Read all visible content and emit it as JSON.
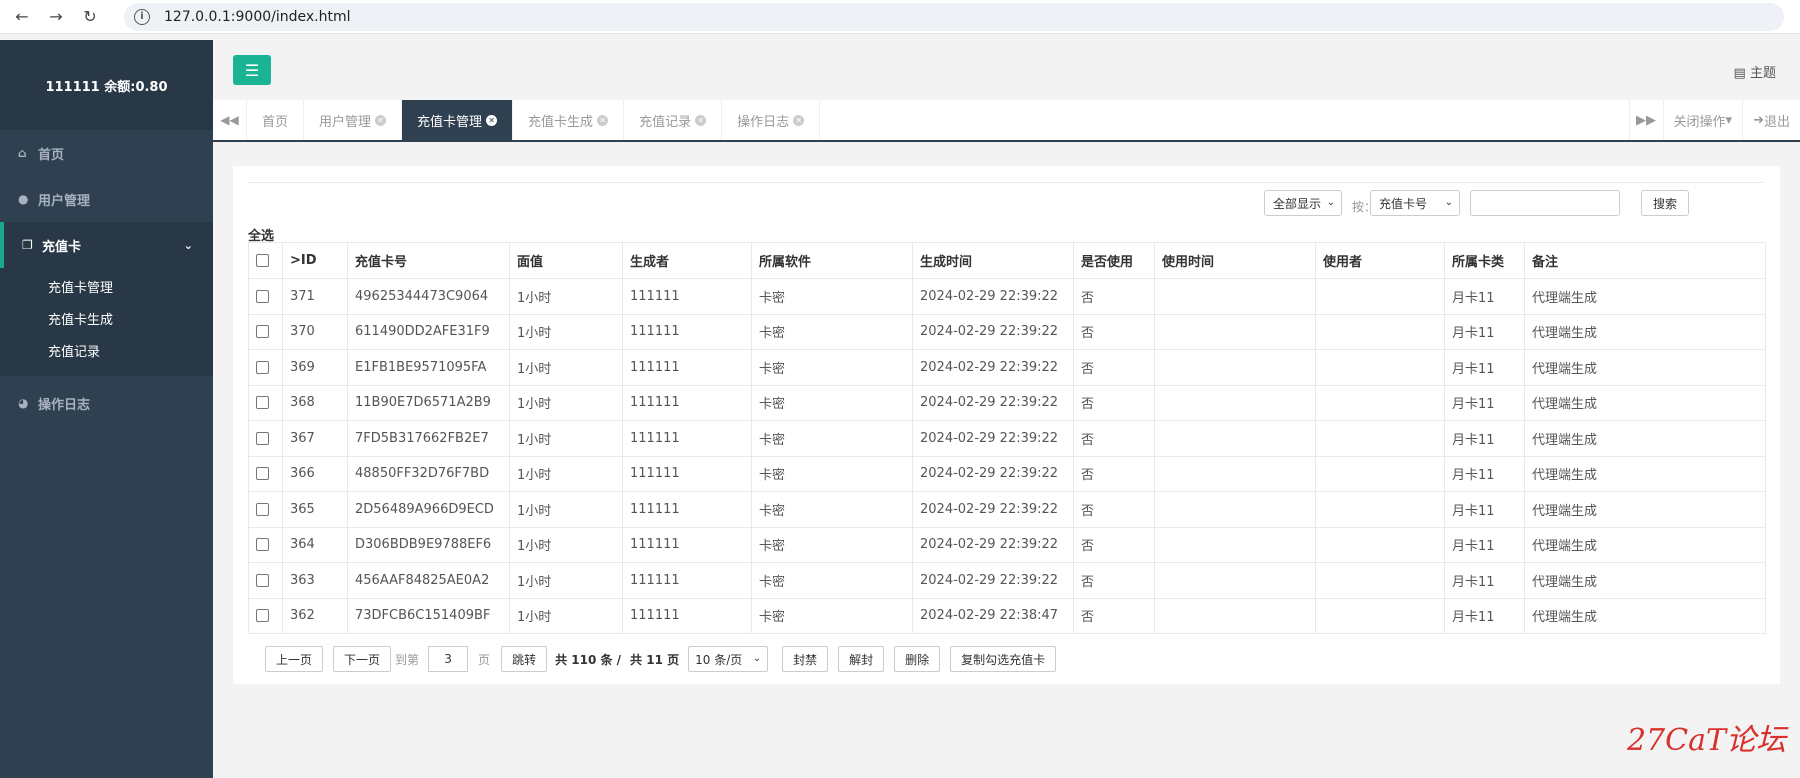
{
  "browser": {
    "url": "127.0.0.1:9000/index.html"
  },
  "sidebar": {
    "user_info": "111111 余额:0.80",
    "items": [
      {
        "label": "首页"
      },
      {
        "label": "用户管理"
      },
      {
        "label": "充值卡"
      },
      {
        "label": "操作日志"
      }
    ],
    "sub_items": [
      {
        "label": "充值卡管理"
      },
      {
        "label": "充值卡生成"
      },
      {
        "label": "充值记录"
      }
    ]
  },
  "header": {
    "theme_label": "主题"
  },
  "tabs": {
    "items": [
      {
        "label": "首页",
        "closable": false
      },
      {
        "label": "用户管理",
        "closable": true
      },
      {
        "label": "充值卡管理",
        "closable": true,
        "active": true
      },
      {
        "label": "充值卡生成",
        "closable": true
      },
      {
        "label": "充值记录",
        "closable": true
      },
      {
        "label": "操作日志",
        "closable": true
      }
    ],
    "close_ops": "关闭操作",
    "logout": "退出"
  },
  "filters": {
    "show_select": "全部显示",
    "by_label": "按：",
    "field_select": "充值卡号",
    "search_value": "",
    "search_button": "搜索"
  },
  "table": {
    "select_all": "全选",
    "headers": [
      "",
      ">ID",
      "充值卡号",
      "面值",
      "生成者",
      "所属软件",
      "生成时间",
      "是否使用",
      "使用时间",
      "使用者",
      "所属卡类",
      "备注"
    ],
    "rows": [
      [
        "371",
        "49625344473C9064",
        "1小时",
        "111111",
        "卡密",
        "2024-02-29 22:39:22",
        "否",
        "",
        "",
        "月卡11",
        "代理端生成"
      ],
      [
        "370",
        "611490DD2AFE31F9",
        "1小时",
        "111111",
        "卡密",
        "2024-02-29 22:39:22",
        "否",
        "",
        "",
        "月卡11",
        "代理端生成"
      ],
      [
        "369",
        "E1FB1BE9571095FA",
        "1小时",
        "111111",
        "卡密",
        "2024-02-29 22:39:22",
        "否",
        "",
        "",
        "月卡11",
        "代理端生成"
      ],
      [
        "368",
        "11B90E7D6571A2B9",
        "1小时",
        "111111",
        "卡密",
        "2024-02-29 22:39:22",
        "否",
        "",
        "",
        "月卡11",
        "代理端生成"
      ],
      [
        "367",
        "7FD5B317662FB2E7",
        "1小时",
        "111111",
        "卡密",
        "2024-02-29 22:39:22",
        "否",
        "",
        "",
        "月卡11",
        "代理端生成"
      ],
      [
        "366",
        "48850FF32D76F7BD",
        "1小时",
        "111111",
        "卡密",
        "2024-02-29 22:39:22",
        "否",
        "",
        "",
        "月卡11",
        "代理端生成"
      ],
      [
        "365",
        "2D56489A966D9ECD",
        "1小时",
        "111111",
        "卡密",
        "2024-02-29 22:39:22",
        "否",
        "",
        "",
        "月卡11",
        "代理端生成"
      ],
      [
        "364",
        "D306BDB9E9788EF6",
        "1小时",
        "111111",
        "卡密",
        "2024-02-29 22:39:22",
        "否",
        "",
        "",
        "月卡11",
        "代理端生成"
      ],
      [
        "363",
        "456AAF84825AE0A2",
        "1小时",
        "111111",
        "卡密",
        "2024-02-29 22:39:22",
        "否",
        "",
        "",
        "月卡11",
        "代理端生成"
      ],
      [
        "362",
        "73DFCB6C151409BF",
        "1小时",
        "111111",
        "卡密",
        "2024-02-29 22:38:47",
        "否",
        "",
        "",
        "月卡11",
        "代理端生成"
      ]
    ]
  },
  "pager": {
    "prev": "上一页",
    "next": "下一页",
    "goto_label": "到第",
    "page_value": "3",
    "page_unit": "页",
    "jump": "跳转",
    "total_records": "共 110 条 /",
    "total_pages": "共 11 页",
    "per_page": "10 条/页",
    "ban": "封禁",
    "unban": "解封",
    "delete": "删除",
    "copy_selected": "复制勾选充值卡"
  },
  "watermark": "27CaT论坛"
}
